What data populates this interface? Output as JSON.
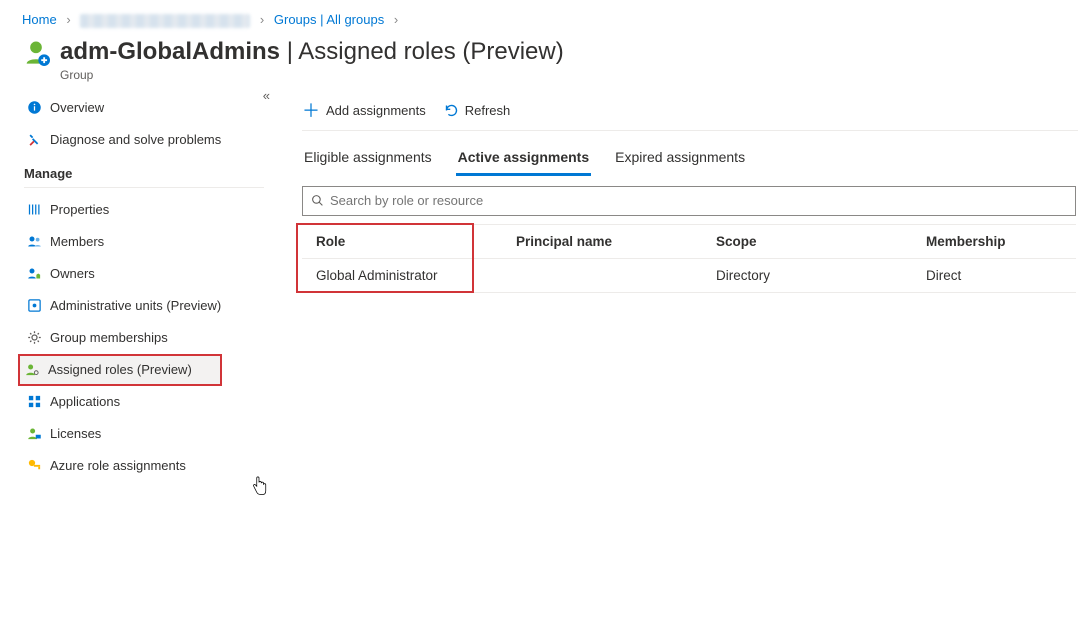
{
  "breadcrumb": {
    "home": "Home",
    "groups": "Groups | All groups"
  },
  "header": {
    "title_left": "adm-GlobalAdmins",
    "title_right": "Assigned roles (Preview)",
    "subtitle": "Group"
  },
  "sidebar": {
    "top": [
      {
        "label": "Overview",
        "icon": "info"
      },
      {
        "label": "Diagnose and solve problems",
        "icon": "wrench"
      }
    ],
    "manage_header": "Manage",
    "manage": [
      {
        "label": "Properties",
        "icon": "props"
      },
      {
        "label": "Members",
        "icon": "members"
      },
      {
        "label": "Owners",
        "icon": "owners"
      },
      {
        "label": "Administrative units (Preview)",
        "icon": "admin-unit"
      },
      {
        "label": "Group memberships",
        "icon": "gear"
      },
      {
        "label": "Assigned roles (Preview)",
        "icon": "person-gear",
        "selected": true,
        "highlight": true
      },
      {
        "label": "Applications",
        "icon": "apps"
      },
      {
        "label": "Licenses",
        "icon": "license"
      },
      {
        "label": "Azure role assignments",
        "icon": "key"
      }
    ]
  },
  "toolbar": {
    "add": "Add assignments",
    "refresh": "Refresh"
  },
  "tabs": [
    {
      "label": "Eligible assignments",
      "active": false
    },
    {
      "label": "Active assignments",
      "active": true
    },
    {
      "label": "Expired assignments",
      "active": false
    }
  ],
  "search": {
    "placeholder": "Search by role or resource"
  },
  "table": {
    "headers": {
      "role": "Role",
      "principal": "Principal name",
      "scope": "Scope",
      "membership": "Membership"
    },
    "rows": [
      {
        "role": "Global Administrator",
        "principal": "",
        "scope": "Directory",
        "membership": "Direct"
      }
    ]
  }
}
